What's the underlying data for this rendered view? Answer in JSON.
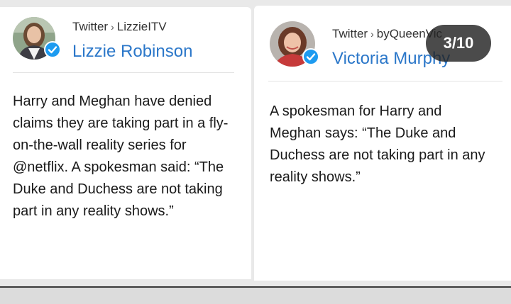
{
  "slide_counter": "3/10",
  "cards": [
    {
      "source_platform": "Twitter",
      "source_account": "LizzieITV",
      "author": "Lizzie Robinson",
      "verified": true,
      "text": "Harry and Meghan have denied claims they are taking part in a fly-on-the-wall reality series for @netflix. A spokesman said: “The Duke and Duchess are not taking part in any reality shows.”"
    },
    {
      "source_platform": "Twitter",
      "source_account": "byQueenVic",
      "author": "Victoria Murphy",
      "verified": true,
      "text": "A spokesman for Harry and Meghan says: “The Duke and Duchess are not taking part in any reality shows.”"
    }
  ],
  "colors": {
    "author_link": "#2b77c9",
    "verified_badge": "#1d9bf0",
    "counter_bg": "#232323"
  }
}
